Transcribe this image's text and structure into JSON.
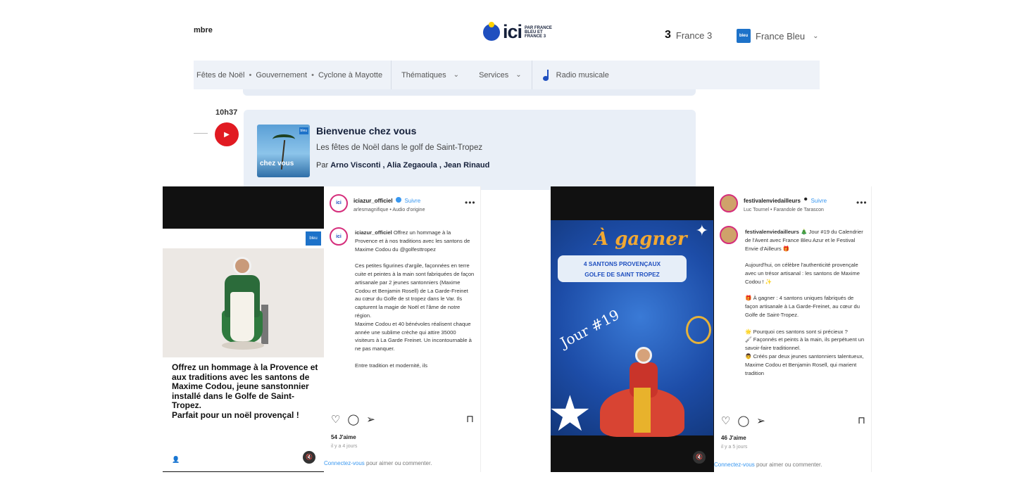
{
  "header": {
    "left_crumb": "mbre",
    "logo_word": "ici",
    "logo_sub": "PAR FRANCE BLEU ET FRANCE 3",
    "france3_mark": "3",
    "france3_label": "France 3",
    "francebleu_label": "France Bleu",
    "francebleu_mark": "bleu"
  },
  "nav": {
    "trending": [
      "Fêtes de Noël",
      "Gouvernement",
      "Cyclone à Mayotte"
    ],
    "separator": "•",
    "menus": [
      "Thématiques",
      "Services"
    ],
    "radio": "Radio musicale"
  },
  "program": {
    "time": "10h37",
    "title": "Bienvenue chez vous",
    "subtitle": "Les fêtes de Noël dans le golf de Saint-Tropez",
    "by_prefix": "Par",
    "authors": "Arno Visconti , Alia Zegaoula , Jean Rinaud",
    "thumb_label": "chez vous",
    "thumb_badge": "bleu"
  },
  "post1": {
    "username": "iciazur_officiel",
    "follow": "Suivre",
    "meta": "arlesmagnifique • Audio d'origine",
    "avatar": "ici",
    "caption": "Offrez un hommage à la Provence et à nos traditions avec les santons de Maxime Codou du @golfesttropez\n\nCes petites figurines d'argile, façonnées en terre cuite et peintes à la main sont fabriquées de façon artisanale par 2 jeunes santonniers (Maxime Codou et Benjamin Rosell) de La Garde-Freinet au cœur du Golfe de st tropez dans le Var. Ils capturent la magie de Noël et l'âme de notre région.\nMaxime Codou et 40 bénévoles réalisent chaque année une sublime crèche qui attire 35000 visiteurs à La Garde Freinet. Un incontournable à ne pas manquer.\n\nEntre tradition et modernité, ils",
    "media_text": "Offrez un hommage à la Provence et aux traditions avec les santons de Maxime Codou, jeune sanstonnier installé dans le Golfe de Saint-Tropez.\nParfait pour un noël provençal !",
    "media_logo": "bleu",
    "likes": "54 J'aime",
    "ago": "il y a 4 jours",
    "connect_link": "Connectez-vous",
    "connect_rest": " pour aimer ou commenter."
  },
  "post2": {
    "username": "festivalenviedailleurs",
    "follow": "Suivre",
    "meta": "Luc Tournel • Farandole de Tarascon",
    "caption": "🎄 Jour #19 du Calendrier de l'Avent avec France Bleu Azur et le Festival Envie d'Ailleurs 🎁\n\nAujourd'hui, on célèbre l'authenticité provençale avec un trésor artisanal : les santons de Maxime Codou ! ✨\n\n🎁 À gagner : 4 santons uniques fabriqués de façon artisanale à La Garde-Freinet, au cœur du Golfe de Saint-Tropez.\n\n🌟 Pourquoi ces santons sont si précieux ?\n🖌 Façonnés et peints à la main, ils perpétuent un savoir-faire traditionnel.\n👨 Créés par deux jeunes santonniers talentueux, Maxime Codou et Benjamin Rosell, qui marient tradition",
    "media_title": "À gagner",
    "banner_line1": "4 SANTONS PROVENÇAUX",
    "banner_line2": "GOLFE DE SAINT TROPEZ",
    "jour": "Jour #19",
    "likes": "46 J'aime",
    "ago": "il y a 5 jours",
    "connect_link": "Connectez-vous",
    "connect_rest": " pour aimer ou commenter."
  },
  "icons": {
    "heart": "♡",
    "comment": "◯",
    "share": "➢",
    "bookmark": "⊓",
    "more": "•••",
    "play": "▶",
    "chevron": "⌄",
    "mute": "🔇",
    "user": "👤"
  },
  "colors": {
    "accent": "#1f4fbf",
    "play_red": "#e11a22",
    "instagram_blue": "#3897f0"
  }
}
